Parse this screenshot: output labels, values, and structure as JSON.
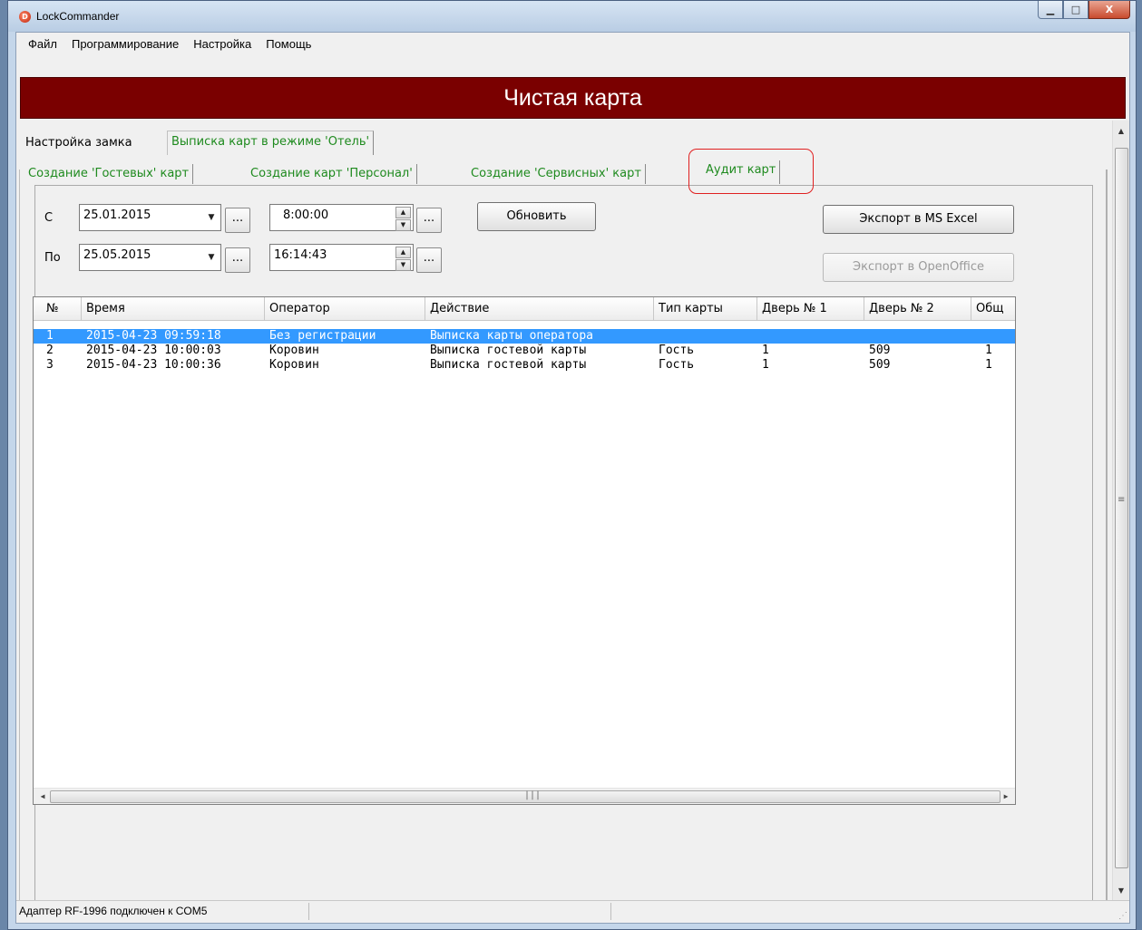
{
  "window": {
    "title": "LockCommander",
    "app_icon_letter": "D",
    "buttons": {
      "minimize": "▁",
      "maximize": "□",
      "close": "X"
    }
  },
  "menu": [
    "Файл",
    "Программирование",
    "Настройка",
    "Помощь"
  ],
  "banner": "Чистая карта",
  "tabs_top": [
    {
      "label": "Настройка замка",
      "active": false
    },
    {
      "label": "Выписка карт в режиме 'Отель'",
      "active": true
    }
  ],
  "tabs_sub": [
    {
      "label": "Создание 'Гостевых' карт",
      "active": false
    },
    {
      "label": "Создание карт 'Персонал'",
      "active": false
    },
    {
      "label": "Создание 'Сервисных' карт",
      "active": false
    },
    {
      "label": "Аудит карт",
      "active": true
    }
  ],
  "filter": {
    "from_label": "С",
    "to_label": "По",
    "from_date": "25.01.2015",
    "to_date": "25.05.2015",
    "from_time": "8:00:00",
    "to_time": "16:14:43",
    "ellipsis": "...",
    "refresh_button": "Обновить",
    "export_excel_button": "Экспорт в MS Excel",
    "export_openoffice_button": "Экспорт в OpenOffice"
  },
  "table": {
    "columns": [
      "№",
      "Время",
      "Оператор",
      "Действие",
      "Тип карты",
      "Дверь № 1",
      "Дверь № 2",
      "Общ"
    ],
    "rows": [
      [
        "1",
        "2015-04-23 09:59:18",
        "Без регистрации",
        "Выписка карты оператора",
        "",
        "",
        "",
        ""
      ],
      [
        "2",
        "2015-04-23 10:00:03",
        "Коровин",
        "Выписка гостевой карты",
        "Гость",
        "1",
        "509",
        "1"
      ],
      [
        "3",
        "2015-04-23 10:00:36",
        "Коровин",
        "Выписка гостевой карты",
        "Гость",
        "1",
        "509",
        "1"
      ]
    ],
    "selected_row": 0
  },
  "status": {
    "adapter": "Адаптер RF-1996 подключен к COM5"
  },
  "colors": {
    "banner_bg": "#7a0000",
    "selection": "#3399ff",
    "tab_text": "#1e8a1e",
    "highlight_outline": "#e02020"
  }
}
